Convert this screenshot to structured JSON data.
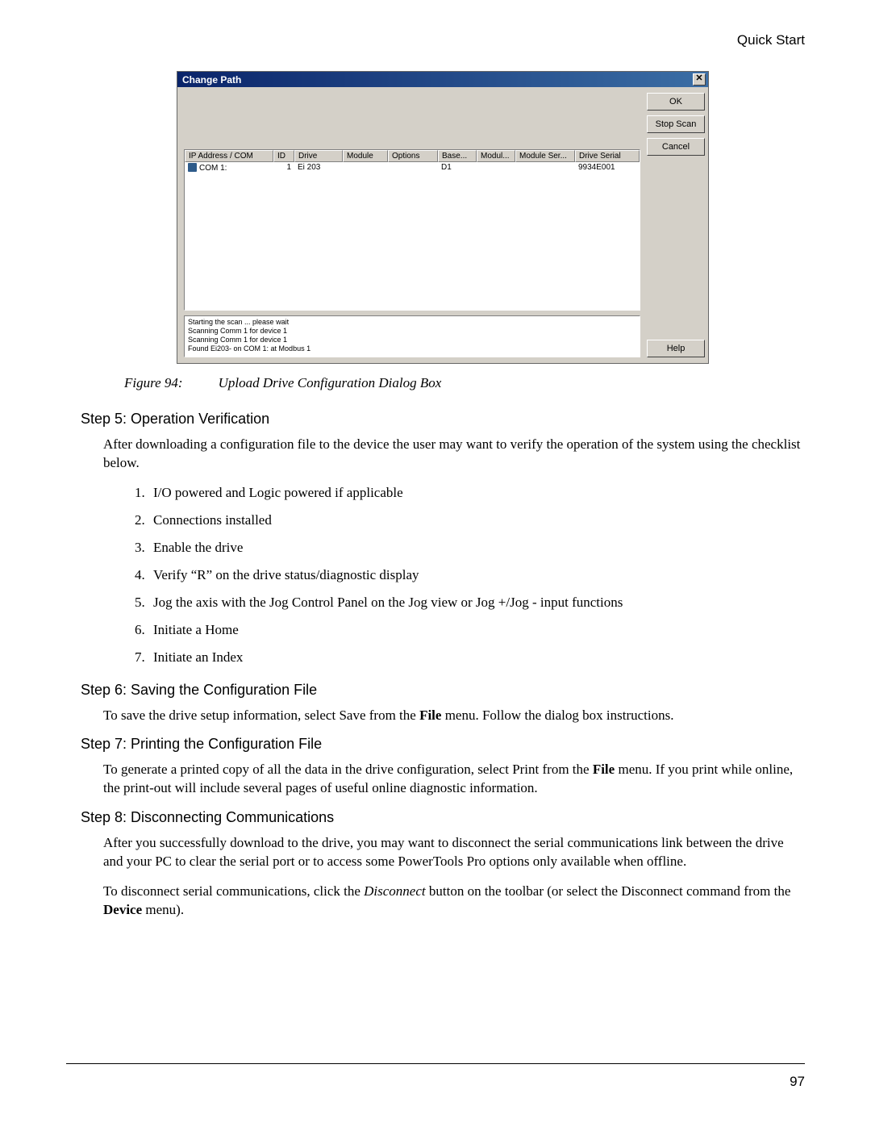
{
  "header": {
    "title": "Quick Start"
  },
  "dialog": {
    "title": "Change Path",
    "close_glyph": "✕",
    "buttons": {
      "ok": "OK",
      "stop_scan": "Stop Scan",
      "cancel": "Cancel",
      "help": "Help"
    },
    "columns": [
      "IP Address / COM",
      "ID",
      "Drive",
      "Module",
      "Options",
      "Base...",
      "Modul...",
      "Module Ser...",
      "Drive Serial"
    ],
    "row": {
      "com": "COM 1:",
      "id": "1",
      "drive": "Ei 203",
      "module": "",
      "options": "",
      "base": "D1",
      "modul": "",
      "module_ser": "",
      "drive_serial": "9934E001"
    },
    "log": [
      "Starting the scan ... please wait",
      "Scanning Comm 1 for device 1",
      "Scanning Comm 1 for device 1",
      "Found Ei203- on COM 1: at Modbus 1"
    ]
  },
  "figure": {
    "number": "Figure 94:",
    "caption": "Upload Drive Configuration Dialog Box"
  },
  "step5": {
    "heading": "Step 5: Operation Verification",
    "intro": "After downloading a configuration file to the device the user may want to verify the operation of the system using the checklist below.",
    "items": [
      "I/O powered and Logic powered if applicable",
      "Connections installed",
      "Enable the drive",
      "Verify “R” on the drive status/diagnostic display",
      "Jog the axis with the Jog Control Panel on the Jog view or Jog +/Jog - input functions",
      "Initiate a Home",
      "Initiate an Index"
    ]
  },
  "step6": {
    "heading": "Step 6: Saving the Configuration File",
    "para_pre": "To save the drive setup information, select Save from the ",
    "file_word": "File",
    "para_post": " menu. Follow the dialog box instructions."
  },
  "step7": {
    "heading": "Step 7: Printing the Configuration File",
    "pre": "To generate a printed copy of all the data in the drive configuration, select Print from the ",
    "file_word": "File",
    "post": " menu. If you print while online, the print-out will include several pages of useful online diagnostic information."
  },
  "step8": {
    "heading": "Step 8: Disconnecting Communications",
    "p1": "After you successfully download to the drive, you may want to disconnect the serial communications link between the drive and your PC to clear the serial port or to access some PowerTools Pro options only available when offline.",
    "p2_pre": "To disconnect serial communications, click the ",
    "disconnect": "Disconnect",
    "p2_mid": " button on the toolbar (or select the Disconnect command from the ",
    "device": "Device",
    "p2_post": " menu)."
  },
  "page_number": "97"
}
